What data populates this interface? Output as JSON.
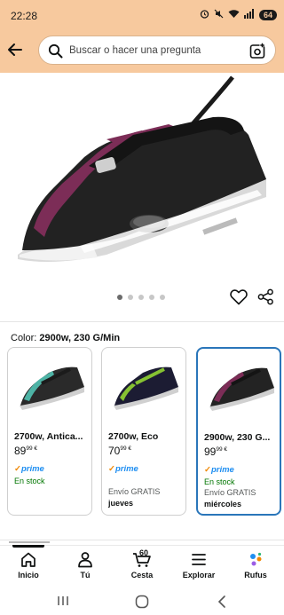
{
  "status": {
    "time": "22:28",
    "battery": "64"
  },
  "search": {
    "placeholder": "Buscar o hacer una pregunta"
  },
  "gallery": {
    "dot_count": 5,
    "active_index": 0
  },
  "variant": {
    "label": "Color:",
    "selected": "2900w, 230 G/Min"
  },
  "cards": [
    {
      "name": "2700w, Antica...",
      "price_whole": "89",
      "price_frac": "99",
      "currency": "€",
      "prime": "prime",
      "stock": "En stock",
      "ship": "",
      "ship_day": "",
      "selected": false
    },
    {
      "name": "2700w, Eco",
      "price_whole": "70",
      "price_frac": "99",
      "currency": "€",
      "prime": "prime",
      "stock": "",
      "ship": "Envío GRATIS",
      "ship_day": "jueves",
      "selected": false
    },
    {
      "name": "2900w, 230 G...",
      "price_whole": "99",
      "price_frac": "99",
      "currency": "€",
      "prime": "prime",
      "stock": "En stock",
      "ship": "Envío GRATIS",
      "ship_day": "miércoles",
      "selected": true
    }
  ],
  "nav": {
    "home": "Inicio",
    "you": "Tú",
    "cart": "Cesta",
    "cart_count": "60",
    "explore": "Explorar",
    "rufus": "Rufus"
  },
  "colors": {
    "accent": "#2a76ba",
    "header_bg": "#f7c99e",
    "stock_green": "#007600",
    "prime_blue": "#1f8ef1"
  }
}
